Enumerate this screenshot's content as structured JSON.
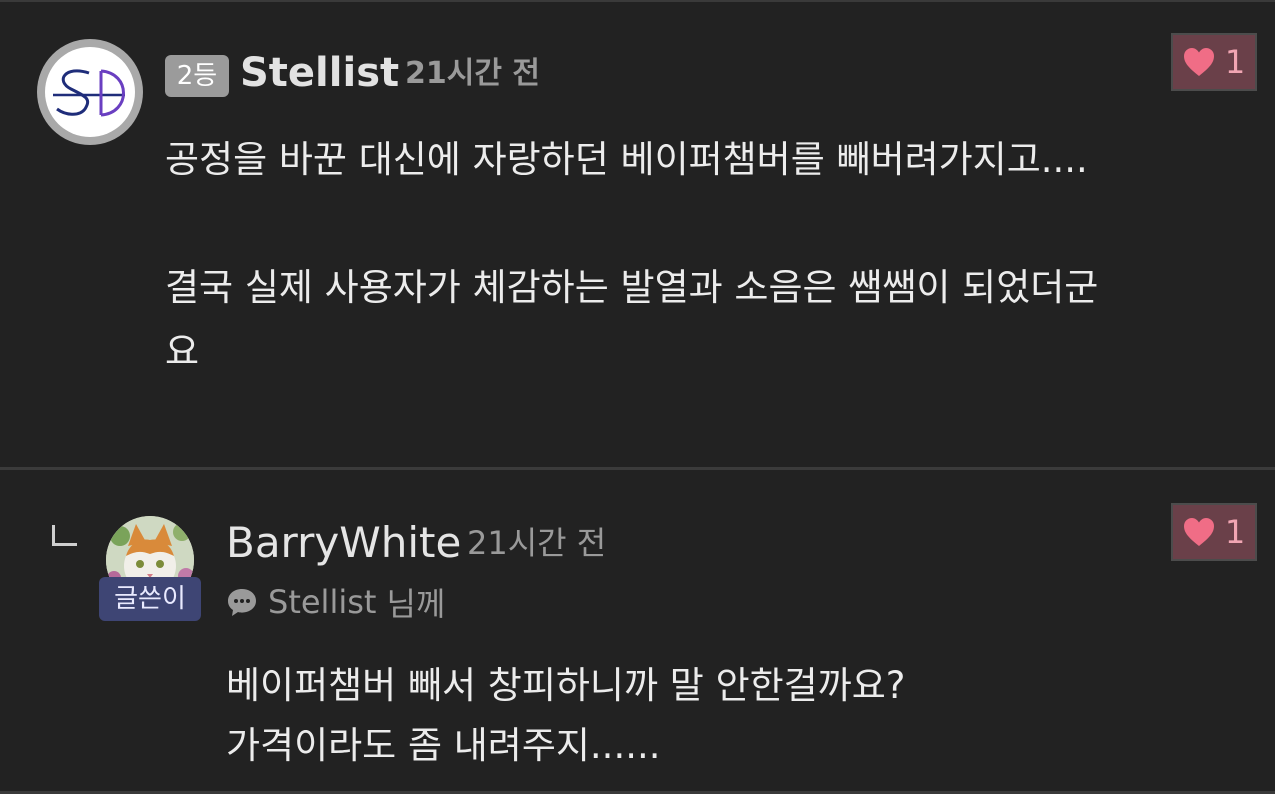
{
  "comments": [
    {
      "rank_badge": "2등",
      "username": "Stellist",
      "time": "21시간 전",
      "likes": "1",
      "body_lines": [
        "공정을 바꾼 대신에 자랑하던 베이퍼챔버를 빼버려가지고....",
        "",
        "결국 실제 사용자가 체감하는 발열과 소음은 쌤쌤이 되었더군",
        "요"
      ]
    },
    {
      "author_badge": "글쓴이",
      "username": "BarryWhite",
      "time": "21시간 전",
      "likes": "1",
      "mention_user": "Stellist",
      "mention_suffix": "님께",
      "body_lines": [
        "베이퍼챔버 빼서 창피하니까 말 안한걸까요?",
        "가격이라도 좀 내려주지......"
      ]
    }
  ],
  "colors": {
    "background": "#222222",
    "like_bg": "#6a4049",
    "like_heart": "#f06d86",
    "author_badge_bg": "#3e4574",
    "rank_badge_bg": "#9b9b9b"
  },
  "icons": {
    "avatar_1": "sd-logo-avatar",
    "avatar_2": "cat-photo-avatar",
    "like": "heart-icon",
    "reply": "reply-arrow-icon",
    "mention": "speech-bubble-icon"
  }
}
